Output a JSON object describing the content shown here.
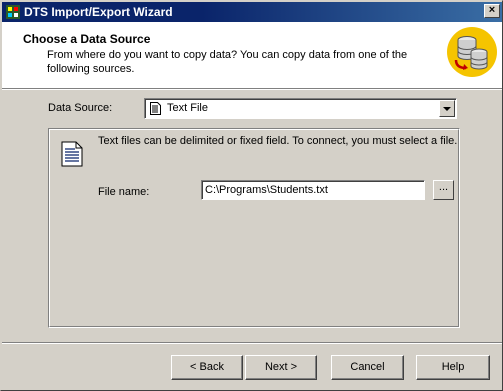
{
  "window": {
    "title": "DTS Import/Export Wizard",
    "close_label": "×"
  },
  "header": {
    "title": "Choose a Data Source",
    "description": "From where do you want to copy data?  You can copy data from one of the following sources."
  },
  "data_source": {
    "label": "Data Source:",
    "selected": "Text File"
  },
  "panel": {
    "description": "Text files can be delimited or fixed field. To connect, you must select a file.",
    "file_label": "File name:",
    "file_value": "C:\\Programs\\Students.txt",
    "browse_label": "..."
  },
  "buttons": {
    "back": "< Back",
    "next": "Next >",
    "cancel": "Cancel",
    "help": "Help"
  },
  "icons": {
    "app": "dts-app-icon",
    "database": "database-copy-icon",
    "document": "text-document-icon"
  },
  "colors": {
    "titlebar": "#0a246a",
    "face": "#d4d0c8",
    "header_bg": "#ffffff",
    "accent": "#f5c400"
  }
}
